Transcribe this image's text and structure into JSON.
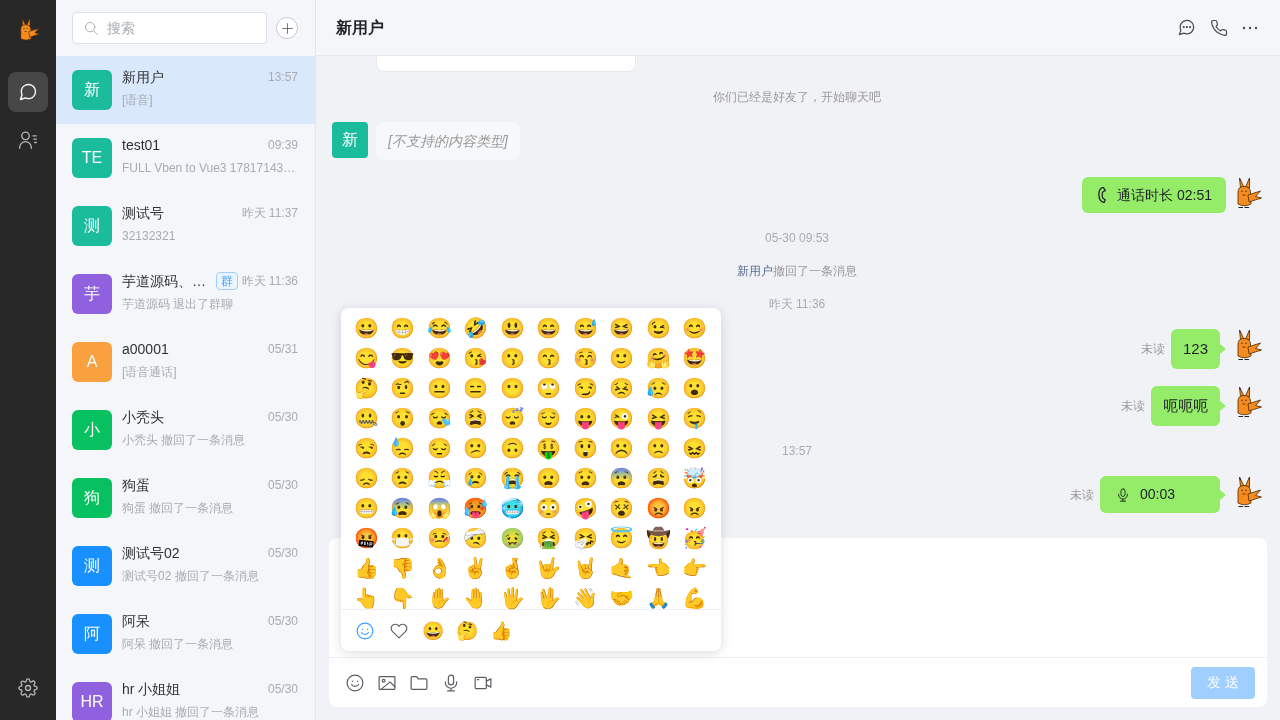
{
  "rail": {
    "items": [
      {
        "kind": "chats",
        "selected": true
      },
      {
        "kind": "contacts",
        "selected": false
      }
    ]
  },
  "search": {
    "placeholder": "搜索"
  },
  "conversations": [
    {
      "name": "新用户",
      "avatar_text": "新",
      "color": "#1abc9c",
      "time": "13:57",
      "preview": "[语音]",
      "selected": true
    },
    {
      "name": "test01",
      "avatar_text": "TE",
      "color": "#1abc9c",
      "time": "09:39",
      "preview": "FULL Vben to Vue3 17817143…",
      "selected": false
    },
    {
      "name": "测试号",
      "avatar_text": "测",
      "color": "#1abc9c",
      "time": "昨天 11:37",
      "preview": "32132321",
      "selected": false
    },
    {
      "name": "芋道源码、…",
      "badge": "群",
      "avatar_text": "芋",
      "color": "#9061df",
      "time": "昨天 11:36",
      "preview": "芋道源码 退出了群聊",
      "selected": false
    },
    {
      "name": "a00001",
      "avatar_text": "A",
      "color": "#f9a03f",
      "time": "05/31",
      "preview": "[语音通话]",
      "selected": false
    },
    {
      "name": "小秃头",
      "avatar_text": "小",
      "color": "#07c160",
      "time": "05/30",
      "preview": "小秃头 撤回了一条消息",
      "selected": false
    },
    {
      "name": "狗蛋",
      "avatar_text": "狗",
      "color": "#07c160",
      "time": "05/30",
      "preview": "狗蛋 撤回了一条消息",
      "selected": false
    },
    {
      "name": "测试号02",
      "avatar_text": "测",
      "color": "#1890ff",
      "time": "05/30",
      "preview": "测试号02 撤回了一条消息",
      "selected": false
    },
    {
      "name": "阿呆",
      "avatar_text": "阿",
      "color": "#1890ff",
      "time": "05/30",
      "preview": "阿呆 撤回了一条消息",
      "selected": false
    },
    {
      "name": "hr 小姐姐",
      "avatar_text": "HR",
      "color": "#9061df",
      "time": "05/30",
      "preview": "hr 小姐姐 撤回了一条消息",
      "selected": false
    }
  ],
  "chat": {
    "title": "新用户",
    "messages": [
      {
        "kind": "card"
      },
      {
        "kind": "notice",
        "text": "你们已经是好友了，开始聊天吧"
      },
      {
        "kind": "incoming",
        "avatar_text": "新",
        "color": "#1abc9c",
        "text": "[不支持的内容类型]"
      },
      {
        "kind": "call",
        "text": "通话时长 02:51"
      },
      {
        "kind": "time",
        "text": "05-30 09:53"
      },
      {
        "kind": "recall",
        "actor": "新用户",
        "text": "撤回了一条消息"
      },
      {
        "kind": "time",
        "text": "昨天 11:36"
      },
      {
        "kind": "text",
        "status": "未读",
        "text": "123"
      },
      {
        "kind": "text",
        "status": "未读",
        "text": "呃呃呃"
      },
      {
        "kind": "time",
        "text": "13:57"
      },
      {
        "kind": "voice",
        "status": "未读",
        "text": "00:03"
      }
    ]
  },
  "emoji_panel": {
    "emojis": [
      "😀",
      "😁",
      "😂",
      "🤣",
      "😃",
      "😄",
      "😅",
      "😆",
      "😉",
      "😊",
      "😋",
      "😎",
      "😍",
      "😘",
      "😗",
      "😙",
      "😚",
      "🙂",
      "🤗",
      "🤩",
      "🤔",
      "🤨",
      "😐",
      "😑",
      "😶",
      "🙄",
      "😏",
      "😣",
      "😥",
      "😮",
      "🤐",
      "😯",
      "😪",
      "😫",
      "😴",
      "😌",
      "😛",
      "😜",
      "😝",
      "🤤",
      "😒",
      "😓",
      "😔",
      "😕",
      "🙃",
      "🤑",
      "😲",
      "☹️",
      "🙁",
      "😖",
      "😞",
      "😟",
      "😤",
      "😢",
      "😭",
      "😦",
      "😧",
      "😨",
      "😩",
      "🤯",
      "😬",
      "😰",
      "😱",
      "🥵",
      "🥶",
      "😳",
      "🤪",
      "😵",
      "😡",
      "😠",
      "🤬",
      "😷",
      "🤒",
      "🤕",
      "🤢",
      "🤮",
      "🤧",
      "😇",
      "🤠",
      "🥳",
      "👍",
      "👎",
      "👌",
      "✌️",
      "🤞",
      "🤟",
      "🤘",
      "🤙",
      "👈",
      "👉",
      "👆",
      "👇",
      "✋",
      "🤚",
      "🖐️",
      "🖖",
      "👋",
      "🤝",
      "🙏",
      "💪"
    ],
    "tabs": [
      {
        "kind": "smiley",
        "selected": true
      },
      {
        "kind": "heart",
        "selected": false
      },
      {
        "kind": "emoji",
        "text": "😀",
        "selected": false
      },
      {
        "kind": "emoji",
        "text": "🤔",
        "selected": false
      },
      {
        "kind": "emoji",
        "text": "👍",
        "selected": false
      }
    ]
  },
  "composer": {
    "tools": [
      {
        "kind": "emoji"
      },
      {
        "kind": "image"
      },
      {
        "kind": "folder"
      },
      {
        "kind": "mic"
      },
      {
        "kind": "video"
      }
    ],
    "send": {
      "label": "发 送",
      "disabled": true
    }
  }
}
